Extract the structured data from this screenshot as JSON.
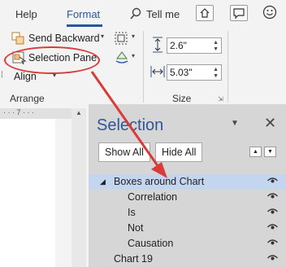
{
  "ribbon": {
    "tabs": [
      "Help",
      "Format"
    ],
    "active_tab": "Format",
    "tell_me": "Tell me",
    "send_backward": "Send Backward",
    "selection_pane": "Selection Pane",
    "align": "Align",
    "height_value": "2.6\"",
    "width_value": "5.03\"",
    "group_arrange": "Arrange",
    "group_size": "Size"
  },
  "pane": {
    "title": "Selection",
    "show_all": "Show All",
    "hide_all": "Hide All",
    "items": [
      {
        "label": "Boxes around Chart",
        "level": 0,
        "expanded": true,
        "selected": true
      },
      {
        "label": "Correlation",
        "level": 1
      },
      {
        "label": "Is",
        "level": 1
      },
      {
        "label": "Not",
        "level": 1
      },
      {
        "label": "Causation",
        "level": 1
      },
      {
        "label": "Chart 19",
        "level": 0
      }
    ]
  },
  "colors": {
    "accent": "#2b579a",
    "annotation": "#d93b3b",
    "selected_row": "#c4d6ef"
  }
}
